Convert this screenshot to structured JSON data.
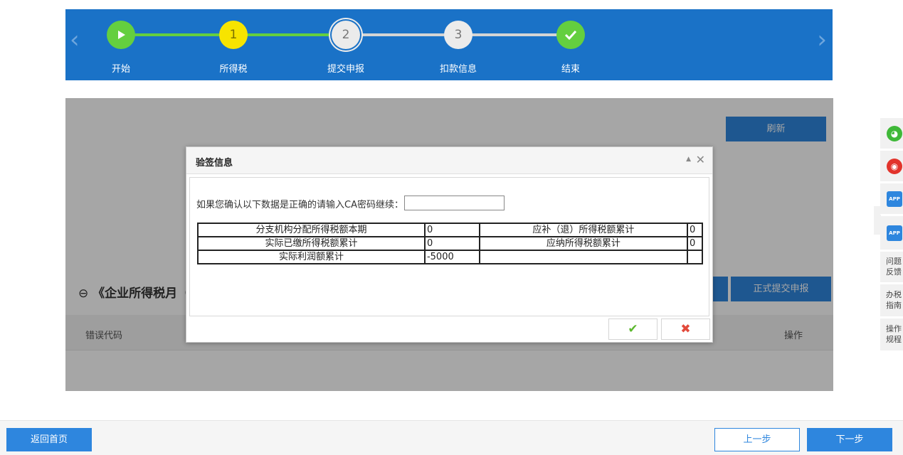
{
  "steps": [
    {
      "number": "",
      "label": "开始",
      "state": "done"
    },
    {
      "number": "1",
      "label": "所得税",
      "state": "active"
    },
    {
      "number": "2",
      "label": "提交申报",
      "state": "current"
    },
    {
      "number": "3",
      "label": "扣款信息",
      "state": "pending"
    },
    {
      "number": "",
      "label": "结束",
      "state": "finished"
    }
  ],
  "nav": {
    "prev_arrow": "‹",
    "next_arrow": "›"
  },
  "content": {
    "refresh_label": "刷新",
    "section_title": "《企业所得税月（",
    "submit_label": "正式提交申报",
    "col_error_code": "错误代码",
    "col_action": "操作"
  },
  "dialog": {
    "title": "验签信息",
    "prompt": "如果您确认以下数据是正确的请输入CA密码继续：",
    "password_value": "",
    "rows": [
      {
        "label1": "分支机构分配所得税额本期",
        "value1": "0",
        "label2": "应补（退）所得税额累计",
        "value2": "0"
      },
      {
        "label1": "实际已缴所得税额累计",
        "value1": "0",
        "label2": "应纳所得税额累计",
        "value2": "0"
      },
      {
        "label1": "实际利润额累计",
        "value1": "-5000",
        "label2": "",
        "value2": ""
      }
    ],
    "ok_icon": "✔",
    "cancel_icon": "✖"
  },
  "sidebar": {
    "items": [
      {
        "icon": "wechat-icon",
        "glyph": "◕",
        "color": "#3fb838"
      },
      {
        "icon": "weibo-icon",
        "glyph": "◉",
        "color": "#e2342c"
      },
      {
        "icon": "app-icon",
        "glyph": "APP",
        "color": "#2e86de"
      },
      {
        "icon": "app-icon",
        "glyph": "APP",
        "color": "#2e86de"
      },
      {
        "label": "问题\n反馈"
      },
      {
        "label": "办税\n指南"
      },
      {
        "label": "操作\n规程"
      }
    ]
  },
  "footer": {
    "home_label": "返回首页",
    "prev_label": "上一步",
    "next_label": "下一步"
  },
  "colors": {
    "stepbar_bg": "#1a72c7",
    "done_green": "#64cf3f",
    "active_yellow": "#f7e400",
    "primary_blue": "#2e86de"
  }
}
